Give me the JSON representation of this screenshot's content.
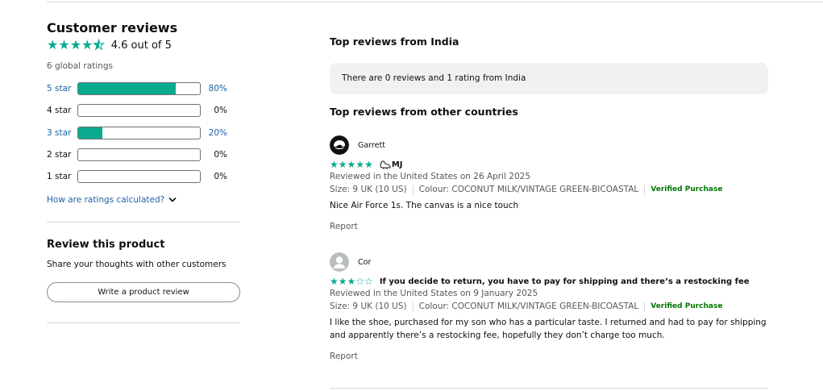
{
  "summary": {
    "title": "Customer reviews",
    "rating_value": 4.6,
    "rating_text": "4.6 out of 5",
    "global_ratings": "6 global ratings",
    "histogram": [
      {
        "label": "5 star",
        "percent": 80,
        "percent_text": "80%",
        "linked": true
      },
      {
        "label": "4 star",
        "percent": 0,
        "percent_text": "0%",
        "linked": false
      },
      {
        "label": "3 star",
        "percent": 20,
        "percent_text": "20%",
        "linked": true
      },
      {
        "label": "2 star",
        "percent": 0,
        "percent_text": "0%",
        "linked": false
      },
      {
        "label": "1 star",
        "percent": 0,
        "percent_text": "0%",
        "linked": false
      }
    ],
    "how_calculated": "How are ratings calculated?",
    "how_icon": "chevron-down-icon"
  },
  "review_product": {
    "title": "Review this product",
    "subtitle": "Share your thoughts with other customers",
    "button_label": "Write a product review"
  },
  "top_india": {
    "title": "Top reviews from India",
    "notice": "There are 0 reviews and 1 rating from India"
  },
  "top_other": {
    "title": "Top reviews from other countries"
  },
  "reviews": [
    {
      "name": "Garrett",
      "avatar_icon": "custom-avatar-icon",
      "stars": 5,
      "title": "MJ",
      "title_icon": "shoe-icon",
      "date": "Reviewed in the United States on 26 April 2025",
      "size": "Size: 9 UK (10 US)",
      "colour": "Colour: COCONUT MILK/VINTAGE GREEN-BICOASTAL",
      "verified": "Verified Purchase",
      "body": "Nice Air Force 1s. The canvas is a nice touch",
      "report": "Report"
    },
    {
      "name": "Cor",
      "avatar_icon": "default-user-avatar-icon",
      "stars": 3,
      "title": "If you decide to return, you have to pay for shipping and there’s a restocking fee",
      "date": "Reviewed in the United States on 9 January 2025",
      "size": "Size: 9 UK (10 US)",
      "colour": "Colour: COCONUT MILK/VINTAGE GREEN-BICOASTAL",
      "verified": "Verified Purchase",
      "body": "I like the shoe, purchased for my son who has a particular taste. I returned and had to pay for shipping and apparently there’s a restocking fee, hopefully they don’t charge too much.",
      "report": "Report"
    }
  ],
  "colors": {
    "star": "#0aaa8f",
    "link": "#2162a1",
    "verified": "#007600",
    "muted": "#565959"
  }
}
